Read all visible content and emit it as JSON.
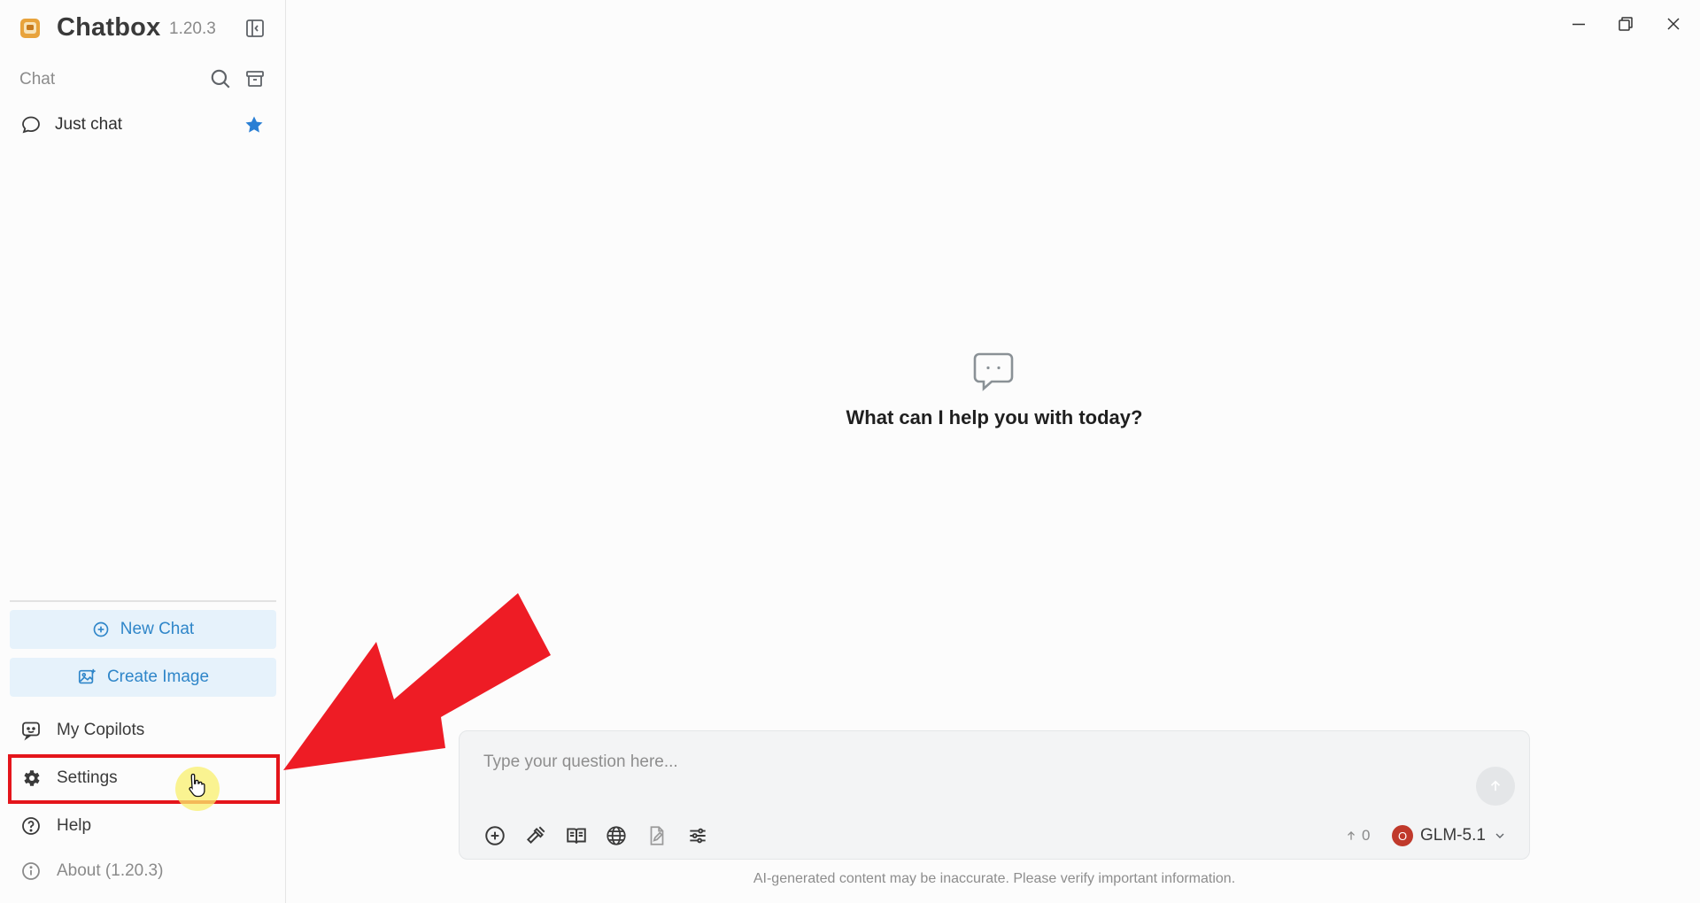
{
  "app": {
    "name": "Chatbox",
    "version": "1.20.3"
  },
  "sidebar": {
    "section_label": "Chat",
    "chats": [
      {
        "label": "Just chat",
        "starred": true
      }
    ],
    "buttons": {
      "new_chat": "New Chat",
      "create_image": "Create Image"
    },
    "menu": {
      "copilots": "My Copilots",
      "settings": "Settings",
      "help": "Help",
      "about": "About (1.20.3)"
    }
  },
  "main": {
    "empty_heading": "What can I help you with today?"
  },
  "composer": {
    "placeholder": "Type your question here...",
    "token_count": "0",
    "provider_badge": "O",
    "model": "GLM-5.1"
  },
  "disclaimer": "AI-generated content may be inaccurate. Please verify important information.",
  "colors": {
    "accent": "#2f86c9",
    "accent_bg": "#e6f2fb",
    "star": "#2a7fd4",
    "annotation_red": "#e4151b",
    "provider_badge": "#c0392b"
  },
  "icons": {
    "logo": "chatbox-logo-icon",
    "collapse": "sidebar-collapse-icon",
    "search": "search-icon",
    "archive": "archive-icon",
    "chat": "chat-bubble-icon",
    "star": "star-icon",
    "new_chat": "plus-circle-icon",
    "create_image": "image-icon",
    "copilots": "copilot-icon",
    "settings": "gear-icon",
    "help": "help-circle-icon",
    "about": "info-icon"
  }
}
